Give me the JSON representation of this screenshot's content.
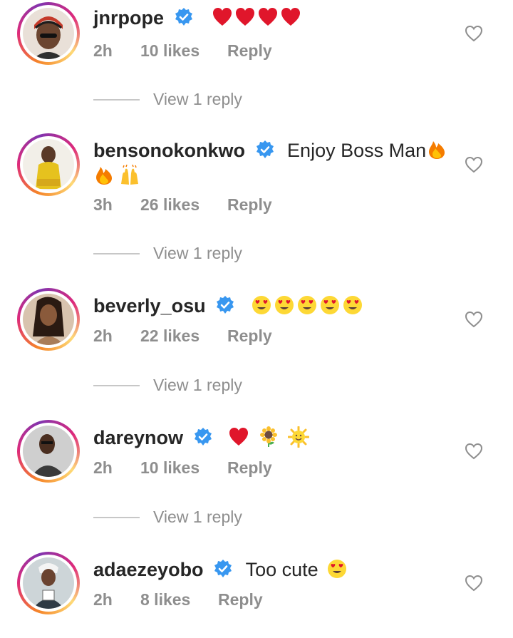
{
  "comments": [
    {
      "username": "jnrpope",
      "text": "",
      "emojis": [
        "red-heart",
        "red-heart",
        "red-heart",
        "red-heart"
      ],
      "wrapped_emojis": [],
      "time": "2h",
      "likes": "10 likes",
      "reply_label": "Reply",
      "view_replies": "View 1 reply",
      "avatar_color": "#c43a2a"
    },
    {
      "username": "bensonokonkwo",
      "text": "Enjoy Boss Man",
      "emojis": [
        "fire"
      ],
      "wrapped_emojis": [
        "fire",
        "raising-hands"
      ],
      "time": "3h",
      "likes": "26 likes",
      "reply_label": "Reply",
      "view_replies": "View 1 reply",
      "avatar_color": "#e6c21e"
    },
    {
      "username": "beverly_osu",
      "text": "",
      "emojis": [
        "heart-eyes",
        "heart-eyes",
        "heart-eyes",
        "heart-eyes",
        "heart-eyes"
      ],
      "wrapped_emojis": [],
      "time": "2h",
      "likes": "22 likes",
      "reply_label": "Reply",
      "view_replies": "View 1 reply",
      "avatar_color": "#8a5a3b"
    },
    {
      "username": "dareynow",
      "text": "",
      "emojis": [
        "red-heart",
        "sunflower",
        "sun-with-face"
      ],
      "wrapped_emojis": [],
      "time": "2h",
      "likes": "10 likes",
      "reply_label": "Reply",
      "view_replies": "View 1 reply",
      "avatar_color": "#3a3a3a"
    },
    {
      "username": "adaezeyobo",
      "text": "Too cute",
      "emojis": [
        "heart-eyes"
      ],
      "wrapped_emojis": [],
      "time": "2h",
      "likes": "8 likes",
      "reply_label": "Reply",
      "view_replies": "",
      "avatar_color": "#2f3a44"
    }
  ],
  "colors": {
    "verified_blue": "#3897f0",
    "secondary_text": "#8e8e8e",
    "primary_text": "#262626",
    "divider": "#c7c7c7",
    "heart_red": "#e0162b"
  },
  "icons": {
    "verified": "verified-badge-icon",
    "like": "heart-outline-icon"
  }
}
